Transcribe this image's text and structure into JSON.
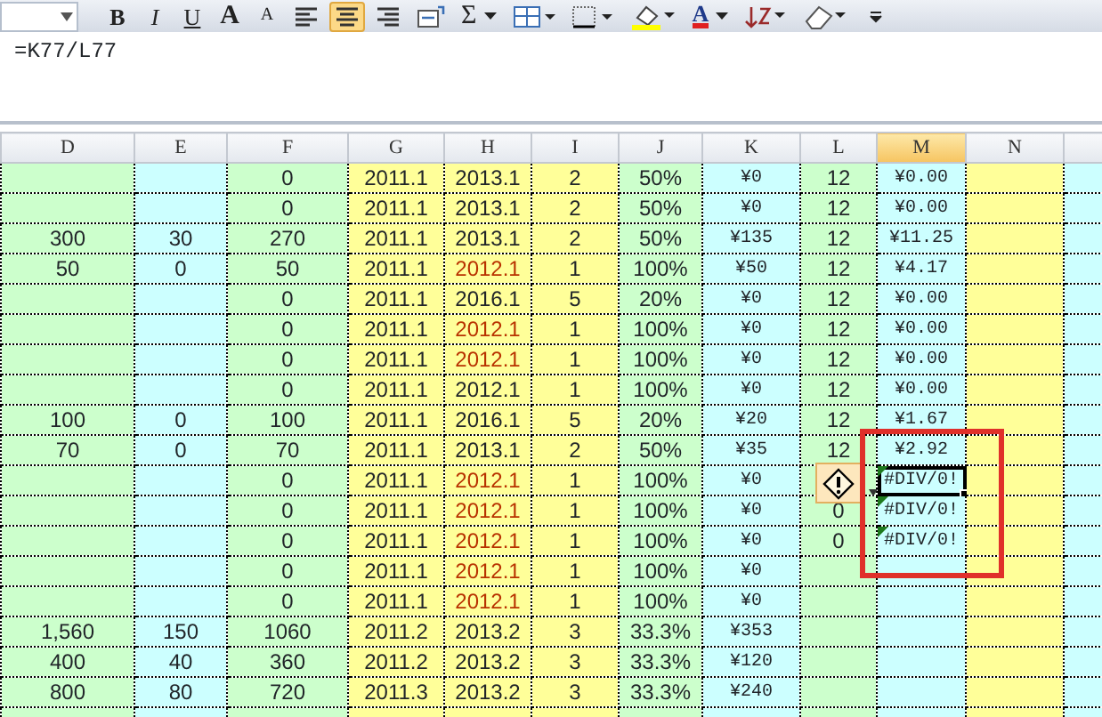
{
  "toolbar": [
    {
      "kind": "namebox"
    },
    {
      "kind": "bold",
      "label": "B",
      "selected": false
    },
    {
      "kind": "italic",
      "label": "I",
      "selected": false
    },
    {
      "kind": "underline",
      "label": "U",
      "selected": false
    },
    {
      "kind": "grow",
      "label": "A",
      "selected": false
    },
    {
      "kind": "shrink",
      "label": "A",
      "selected": false
    },
    {
      "kind": "align-left",
      "selected": false
    },
    {
      "kind": "align-center",
      "selected": true
    },
    {
      "kind": "align-right",
      "selected": false
    },
    {
      "kind": "merge",
      "selected": false
    },
    {
      "kind": "sum",
      "label": "Σ",
      "selected": false
    },
    {
      "kind": "insert",
      "selected": false
    },
    {
      "kind": "borders",
      "selected": false
    },
    {
      "kind": "fill-color",
      "selected": false
    },
    {
      "kind": "font-color",
      "label": "A",
      "selected": false
    },
    {
      "kind": "sort",
      "selected": false
    },
    {
      "kind": "eraser",
      "selected": false
    },
    {
      "kind": "more",
      "selected": false
    }
  ],
  "formula_bar": {
    "value": "=K77/L77"
  },
  "sheet": {
    "columns": [
      {
        "label": "D",
        "color": "#ccffcc",
        "selected": false
      },
      {
        "label": "E",
        "color": "#ccffff",
        "selected": false
      },
      {
        "label": "F",
        "color": "#ccffcc",
        "selected": false
      },
      {
        "label": "G",
        "color": "#ffff99",
        "selected": false
      },
      {
        "label": "H",
        "color": "#ffff99",
        "selected": false
      },
      {
        "label": "I",
        "color": "#ffff99",
        "selected": false
      },
      {
        "label": "J",
        "color": "#ccffcc",
        "selected": false
      },
      {
        "label": "K",
        "color": "#ccffff",
        "selected": false
      },
      {
        "label": "L",
        "color": "#ccffcc",
        "selected": false
      },
      {
        "label": "M",
        "color": "#ccffff",
        "selected": true
      },
      {
        "label": "N",
        "color": "#ffff99",
        "selected": false
      },
      {
        "color": "#ccffff",
        "selected": false
      }
    ],
    "rows": [
      {
        "f": "0",
        "g": "2011.1",
        "h": "2013.1",
        "i": "2",
        "j": "50%",
        "k": "¥0",
        "l": "12",
        "m": "¥0.00",
        "late": false,
        "error_flag": false,
        "selected_cell": false
      },
      {
        "f": "0",
        "g": "2011.1",
        "h": "2013.1",
        "i": "2",
        "j": "50%",
        "k": "¥0",
        "l": "12",
        "m": "¥0.00",
        "late": false,
        "error_flag": false,
        "selected_cell": false
      },
      {
        "d": "300",
        "e": "30",
        "f": "270",
        "g": "2011.1",
        "h": "2013.1",
        "i": "2",
        "j": "50%",
        "k": "¥135",
        "l": "12",
        "m": "¥11.25",
        "late": false,
        "error_flag": false,
        "selected_cell": false
      },
      {
        "d": "50",
        "e": "0",
        "f": "50",
        "g": "2011.1",
        "h": "2012.1",
        "i": "1",
        "j": "100%",
        "k": "¥50",
        "l": "12",
        "m": "¥4.17",
        "late": true,
        "error_flag": false,
        "selected_cell": false
      },
      {
        "f": "0",
        "g": "2011.1",
        "h": "2016.1",
        "i": "5",
        "j": "20%",
        "k": "¥0",
        "l": "12",
        "m": "¥0.00",
        "late": false,
        "error_flag": false,
        "selected_cell": false
      },
      {
        "f": "0",
        "g": "2011.1",
        "h": "2012.1",
        "i": "1",
        "j": "100%",
        "k": "¥0",
        "l": "12",
        "m": "¥0.00",
        "late": true,
        "error_flag": false,
        "selected_cell": false
      },
      {
        "f": "0",
        "g": "2011.1",
        "h": "2012.1",
        "i": "1",
        "j": "100%",
        "k": "¥0",
        "l": "12",
        "m": "¥0.00",
        "late": true,
        "error_flag": false,
        "selected_cell": false
      },
      {
        "f": "0",
        "g": "2011.1",
        "h": "2012.1",
        "i": "1",
        "j": "100%",
        "k": "¥0",
        "l": "12",
        "m": "¥0.00",
        "late": false,
        "error_flag": false,
        "selected_cell": false
      },
      {
        "d": "100",
        "e": "0",
        "f": "100",
        "g": "2011.1",
        "h": "2016.1",
        "i": "5",
        "j": "20%",
        "k": "¥20",
        "l": "12",
        "m": "¥1.67",
        "late": false,
        "error_flag": false,
        "selected_cell": false
      },
      {
        "d": "70",
        "e": "0",
        "f": "70",
        "g": "2011.1",
        "h": "2013.1",
        "i": "2",
        "j": "50%",
        "k": "¥35",
        "l": "12",
        "m": "¥2.92",
        "late": false,
        "error_flag": false,
        "selected_cell": false,
        "annotation_box": true
      },
      {
        "f": "0",
        "g": "2011.1",
        "h": "2012.1",
        "i": "1",
        "j": "100%",
        "k": "¥0",
        "m": "#DIV/0!",
        "late": true,
        "error_flag": true,
        "selected_cell": true,
        "error_button": true
      },
      {
        "f": "0",
        "g": "2011.1",
        "h": "2012.1",
        "i": "1",
        "j": "100%",
        "k": "¥0",
        "l": "0",
        "m": "#DIV/0!",
        "late": true,
        "error_flag": true,
        "selected_cell": false
      },
      {
        "f": "0",
        "g": "2011.1",
        "h": "2012.1",
        "i": "1",
        "j": "100%",
        "k": "¥0",
        "l": "0",
        "m": "#DIV/0!",
        "late": true,
        "error_flag": true,
        "selected_cell": false
      },
      {
        "f": "0",
        "g": "2011.1",
        "h": "2012.1",
        "i": "1",
        "j": "100%",
        "k": "¥0",
        "late": true,
        "error_flag": false,
        "selected_cell": false
      },
      {
        "f": "0",
        "g": "2011.1",
        "h": "2012.1",
        "i": "1",
        "j": "100%",
        "k": "¥0",
        "late": true,
        "error_flag": false,
        "selected_cell": false
      },
      {
        "d": "1,560",
        "e": "150",
        "f": "1060",
        "g": "2011.2",
        "h": "2013.2",
        "i": "3",
        "j": "33.3%",
        "k": "¥353",
        "late": false,
        "error_flag": false,
        "selected_cell": false
      },
      {
        "d": "400",
        "e": "40",
        "f": "360",
        "g": "2011.2",
        "h": "2013.2",
        "i": "3",
        "j": "33.3%",
        "k": "¥120",
        "late": false,
        "error_flag": false,
        "selected_cell": false
      },
      {
        "d": "800",
        "e": "80",
        "f": "720",
        "g": "2011.3",
        "h": "2013.2",
        "i": "3",
        "j": "33.3%",
        "k": "¥240",
        "late": false,
        "error_flag": false,
        "selected_cell": false
      }
    ]
  }
}
